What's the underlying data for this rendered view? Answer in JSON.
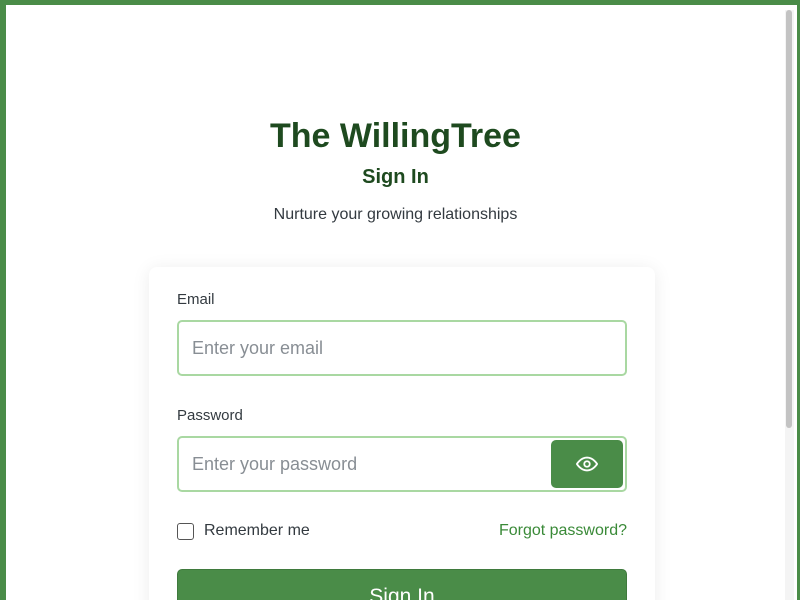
{
  "header": {
    "app_title": "The WillingTree",
    "form_title": "Sign In",
    "tagline": "Nurture your growing relationships"
  },
  "form": {
    "email_label": "Email",
    "email_placeholder": "Enter your email",
    "password_label": "Password",
    "password_placeholder": "Enter your password",
    "show_password_icon": "eye-icon",
    "remember_label": "Remember me",
    "forgot_link": "Forgot password?",
    "submit_label": "Sign In"
  },
  "colors": {
    "accent": "#4a8c48",
    "title": "#1e4a1f",
    "input_border": "#a9d8a2",
    "link": "#3a8a38"
  }
}
